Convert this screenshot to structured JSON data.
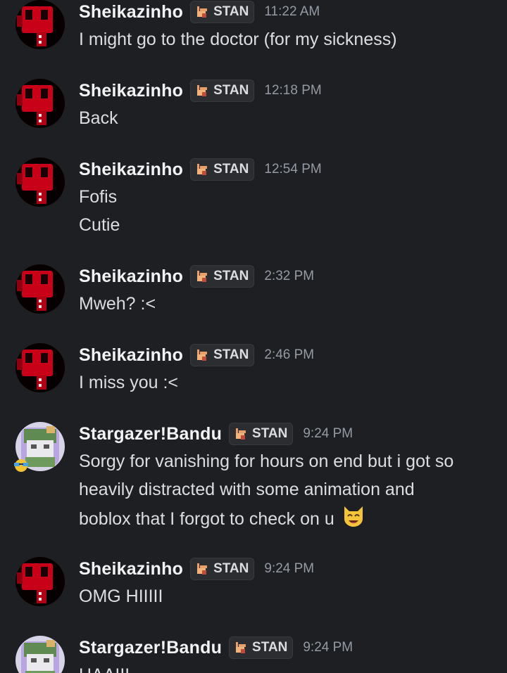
{
  "tag_label": "STAN",
  "messages": [
    {
      "author": "Sheikazinho",
      "time": "11:22 AM",
      "lines": [
        "I might go to the doctor (for my sickness)"
      ]
    },
    {
      "author": "Sheikazinho",
      "time": "12:18 PM",
      "lines": [
        "Back"
      ]
    },
    {
      "author": "Sheikazinho",
      "time": "12:54 PM",
      "lines": [
        "Fofis",
        "Cutie"
      ]
    },
    {
      "author": "Sheikazinho",
      "time": "2:32 PM",
      "lines": [
        "Mweh? :<"
      ]
    },
    {
      "author": "Sheikazinho",
      "time": "2:46 PM",
      "lines": [
        "I miss you :<"
      ]
    },
    {
      "author": "Stargazer!Bandu",
      "time": "9:24 PM",
      "lines": [
        "Sorgy for vanishing for hours on end but i got so",
        "heavily distracted with some animation and",
        "boblox that I forgot to check on u"
      ],
      "trailing_emoji": "smiling-cat-emoji"
    },
    {
      "author": "Sheikazinho",
      "time": "9:24 PM",
      "lines": [
        "OMG HIIIII"
      ]
    },
    {
      "author": "Stargazer!Bandu",
      "time": "9:24 PM",
      "lines": [
        "HAAIII"
      ]
    }
  ],
  "colors": {
    "background": "#1e1f22",
    "username": "#f2f3f5",
    "message_text": "#dbdee1",
    "timestamp": "#949ba4",
    "tag_bg": "#2b2d31",
    "avatar_red": "#d3001a"
  }
}
